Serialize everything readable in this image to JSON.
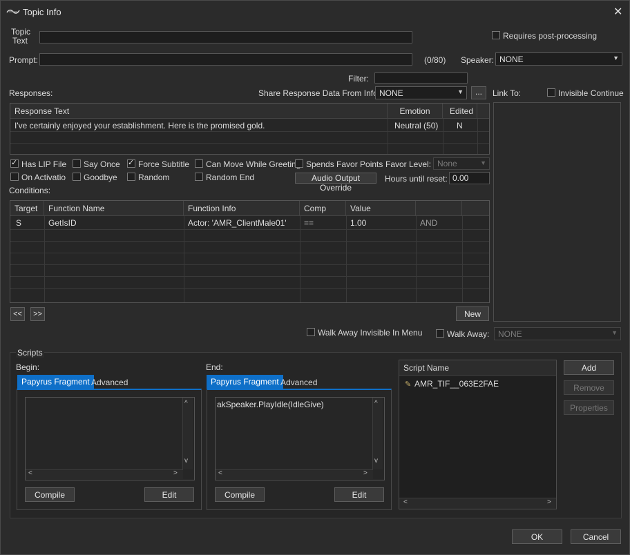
{
  "window": {
    "title": "Topic Info",
    "close": "✕"
  },
  "topic_text": {
    "label": "Topic\nText",
    "value": ""
  },
  "requires_post_processing": {
    "label": "Requires post-processing",
    "checked": false
  },
  "prompt": {
    "label": "Prompt:",
    "value": "",
    "counter": "(0/80)"
  },
  "speaker": {
    "label": "Speaker:",
    "value": "NONE"
  },
  "filter": {
    "label": "Filter:",
    "value": ""
  },
  "responses": {
    "label": "Responses:",
    "share_label": "Share Response Data From Info:",
    "share_value": "NONE",
    "share_more": "...",
    "columns": [
      "Response Text",
      "Emotion",
      "Edited"
    ],
    "rows": [
      [
        "I've certainly enjoyed your establishment. Here is the promised gold.",
        "Neutral (50)",
        "N"
      ]
    ]
  },
  "link_to": {
    "label": "Link To:"
  },
  "invisible_continue": {
    "label": "Invisible Continue",
    "checked": false
  },
  "flags": {
    "has_lip_file": {
      "label": "Has LIP File",
      "checked": true
    },
    "say_once": {
      "label": "Say Once",
      "checked": false
    },
    "force_subtitle": {
      "label": "Force Subtitle",
      "checked": true
    },
    "can_move": {
      "label": "Can Move While Greeting",
      "checked": false
    },
    "spends_favor": {
      "label": "Spends Favor Points",
      "checked": false
    },
    "on_activation": {
      "label": "On Activation",
      "checked": false
    },
    "goodbye": {
      "label": "Goodbye",
      "checked": false
    },
    "random": {
      "label": "Random",
      "checked": false
    },
    "random_end": {
      "label": "Random End",
      "checked": false
    }
  },
  "favor_level": {
    "label": "Favor Level:",
    "value": "None"
  },
  "audio_output_override": {
    "label": "Audio Output Override"
  },
  "hours_until_reset": {
    "label": "Hours until reset:",
    "value": "0.00"
  },
  "conditions": {
    "label": "Conditions:",
    "columns": [
      "Target",
      "Function Name",
      "Function Info",
      "Comp",
      "Value",
      ""
    ],
    "rows": [
      [
        "S",
        "GetIsID",
        "Actor: 'AMR_ClientMale01'",
        "==",
        "1.00",
        "AND"
      ]
    ],
    "prev": "<<",
    "next": ">>",
    "new": "New"
  },
  "walk_away_invisible": {
    "label": "Walk Away Invisible In Menu",
    "checked": false
  },
  "walk_away": {
    "label": "Walk Away:",
    "checked": false,
    "value": "NONE"
  },
  "scripts": {
    "label": "Scripts",
    "begin": {
      "label": "Begin:",
      "tabs": [
        "Papyrus Fragment",
        "Advanced"
      ],
      "code": "",
      "compile": "Compile",
      "edit": "Edit"
    },
    "end": {
      "label": "End:",
      "tabs": [
        "Papyrus Fragment",
        "Advanced"
      ],
      "code": "akSpeaker.PlayIdle(IdleGive)",
      "compile": "Compile",
      "edit": "Edit"
    },
    "list_header": "Script Name",
    "list": [
      "AMR_TIF__063E2FAE"
    ],
    "add": "Add",
    "remove": "Remove",
    "properties": "Properties"
  },
  "footer": {
    "ok": "OK",
    "cancel": "Cancel"
  }
}
